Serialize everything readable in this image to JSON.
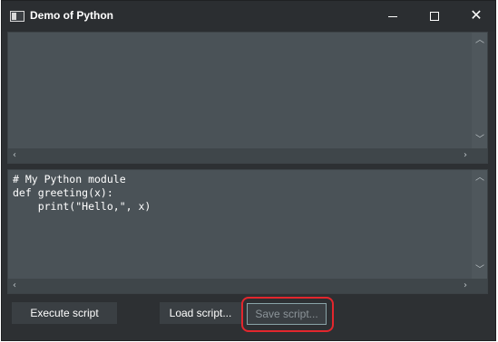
{
  "window": {
    "title": "Demo of Python",
    "controls": {
      "minimize": "minimize",
      "maximize": "maximize",
      "close": "close"
    }
  },
  "output_pane": {
    "text": ""
  },
  "editor_pane": {
    "lines": [
      "# My Python module",
      "def greeting(x):",
      "    print(\"Hello,\", x)"
    ]
  },
  "buttons": {
    "execute": "Execute script",
    "load": "Load script...",
    "save": "Save script..."
  },
  "colors": {
    "highlight": "#e3262d"
  }
}
